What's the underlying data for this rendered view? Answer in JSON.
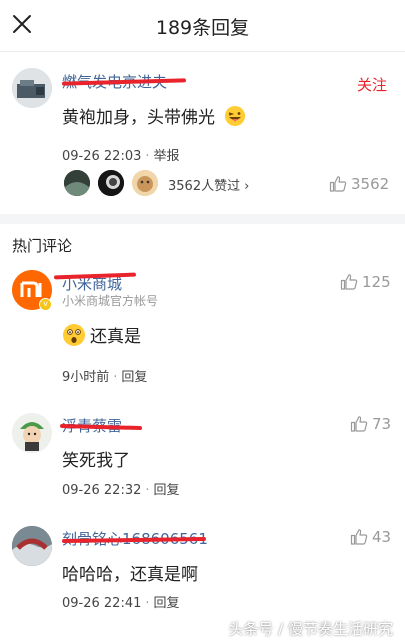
{
  "header": {
    "title": "189条回复",
    "close_icon": "close-icon"
  },
  "main_comment": {
    "user_name": "燃气发电京进夫",
    "follow_label": "关注",
    "content": "黄袍加身，头带佛光",
    "emoji": "grinning-tongue-emoji",
    "time": "09-26 22:03",
    "report_label": "举报",
    "liked_text": "3562人赞过",
    "likes": "3562"
  },
  "hot_section": {
    "title": "热门评论"
  },
  "comments": [
    {
      "user_name": "小米商城",
      "subtitle": "小米商城官方帐号",
      "content": "还真是",
      "time": "9小时前",
      "reply_label": "回复",
      "likes": "125"
    },
    {
      "user_name": "浮青蔡雷",
      "content": "笑死我了",
      "time": "09-26 22:32",
      "reply_label": "回复",
      "likes": "73"
    },
    {
      "user_name": "刻骨铭心168606561",
      "content": "哈哈哈，还真是啊",
      "time": "09-26 22:41",
      "reply_label": "回复",
      "likes": "43"
    }
  ],
  "watermark": "头条号 / 慢节奏生活研究",
  "colors": {
    "accent_red": "#e8232b",
    "name_blue": "#406599",
    "muted": "#999999"
  }
}
